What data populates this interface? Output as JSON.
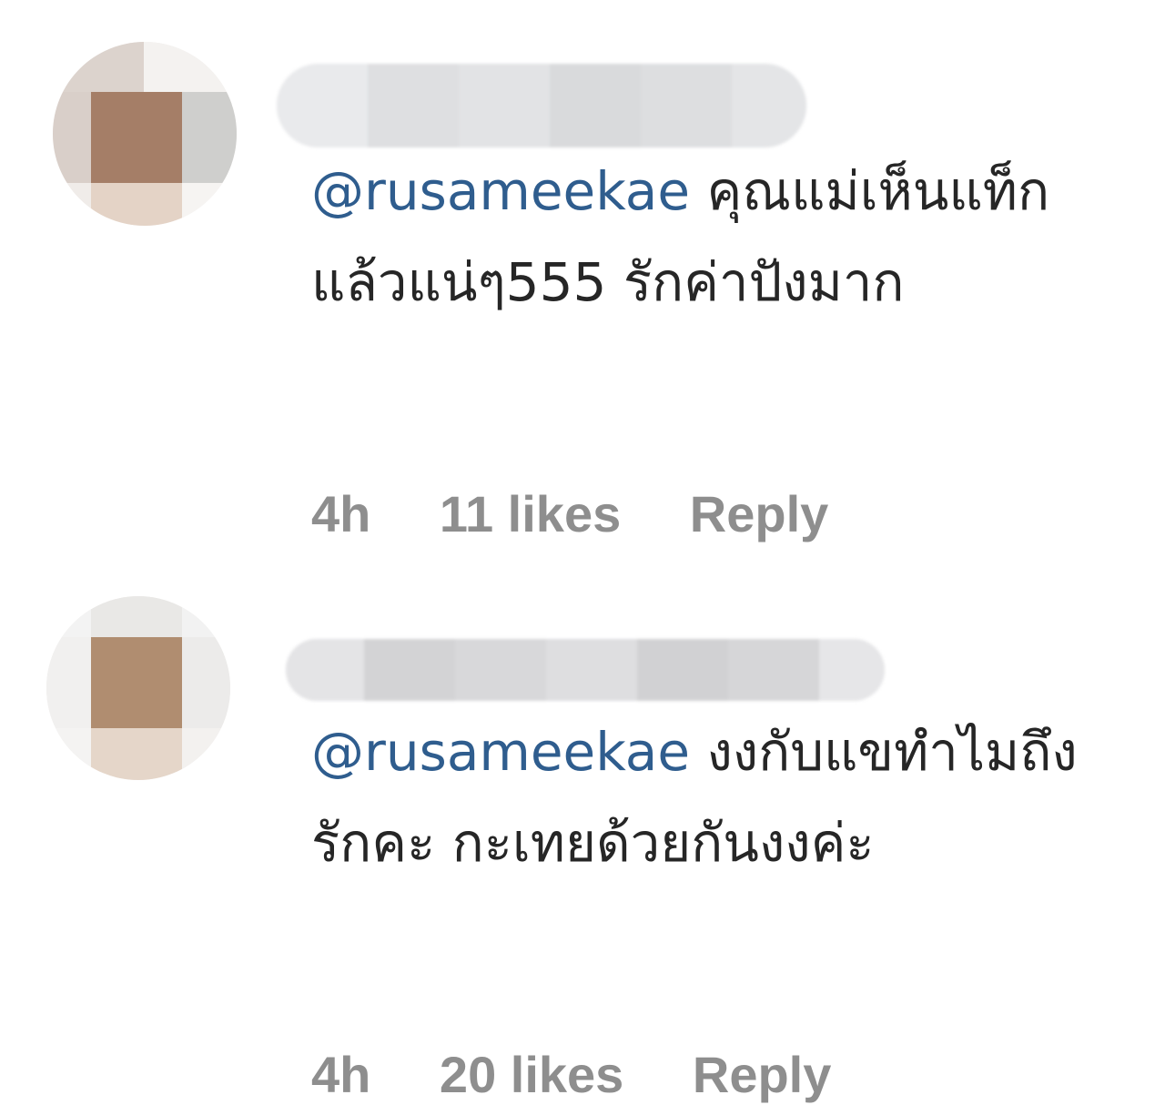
{
  "comments": [
    {
      "mention": "@rusameekae",
      "text": "คุณแม่เห็นแท็กแล้วแน่ๆ555 รักค่าปังมาก",
      "time": "4h",
      "likes": "11 likes",
      "reply_label": "Reply"
    },
    {
      "mention": "@rusameekae",
      "text": "งงกับแขทำไมถึงรักคะ กะเทยด้วยกันงงค่ะ",
      "time": "4h",
      "likes": "20 likes",
      "reply_label": "Reply"
    }
  ],
  "colors": {
    "mention": "#2f5d8e",
    "text": "#262626",
    "meta": "#8e8e8e"
  },
  "icons": {
    "avatar": "pixelated-avatar",
    "username": "blurred-username"
  }
}
